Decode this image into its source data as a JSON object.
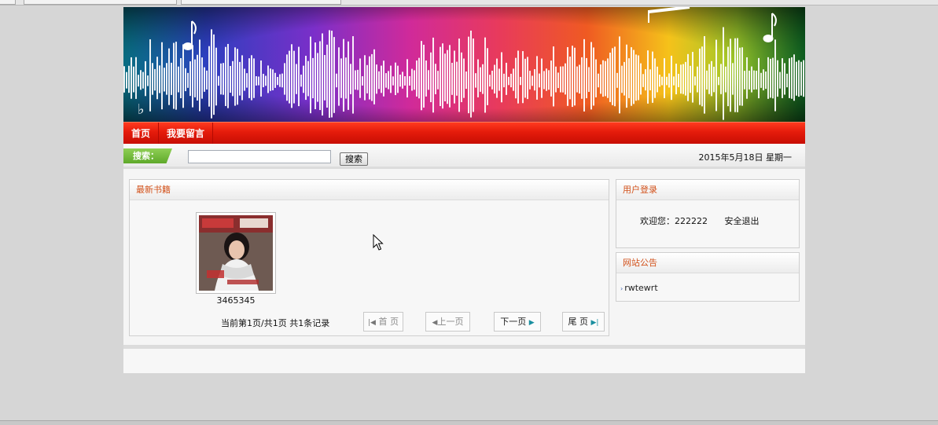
{
  "nav": {
    "items": [
      "首页",
      "我要留言"
    ]
  },
  "search": {
    "label": "搜索：",
    "value": "",
    "button": "搜索"
  },
  "date_text": "2015年5月18日 星期一",
  "books_panel": {
    "title": "最新书籍",
    "books": [
      {
        "title": "3465345",
        "cover": "magazine-cover"
      }
    ],
    "pager": {
      "info": "当前第1页/共1页  共1条记录",
      "first": "首 页",
      "prev": "上一页",
      "next": "下一页",
      "last": "尾 页"
    }
  },
  "login_panel": {
    "title": "用户登录",
    "welcome": "欢迎您：222222",
    "logout": "安全退出"
  },
  "notice_panel": {
    "title": "网站公告",
    "items": [
      "rwtewrt"
    ]
  },
  "colors": {
    "nav_red": "#e41b0b",
    "search_green": "#6ab833",
    "panel_title": "#d2511a"
  }
}
